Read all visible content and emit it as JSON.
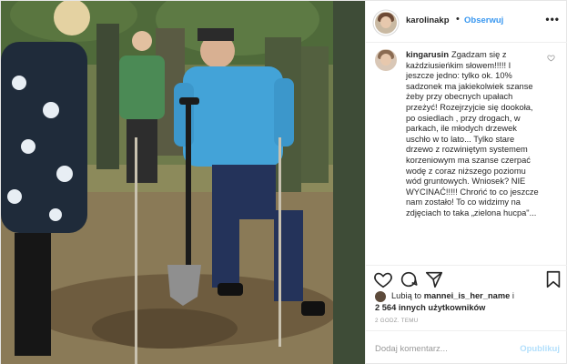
{
  "post": {
    "username": "karolinakp",
    "separator": "•",
    "follow_label": "Obserwuj",
    "more_icon": "more-options-icon"
  },
  "comment": {
    "username": "kingarusin",
    "text": "Zgadzam się z każdziusieńkim słowem!!!!! I jeszcze jedno: tylko ok. 10% sadzonek ma jakiekolwiek szanse żeby przy obecnych upałach przeżyć! Rozejrzyjcie się dookoła, po osiedlach , przy drogach, w parkach, ile młodych drzewek uschło w to lato... Tylko stare drzewo z rozwiniętym systemem korzeniowym ma szanse czerpać wodę z coraz niższego poziomu wód gruntowych. Wniosek? NIE WYCINAĆ!!!!! Chrońć to co jeszcze nam zostało! To co widzimy na zdjęciach to taka „zielona hucpa\"..."
  },
  "likes": {
    "prefix": "Lubią to",
    "user": "mannei_is_her_name",
    "conjunction": "i",
    "others": "2 564 innych użytkowników"
  },
  "time_label": "2 GODZ. TEMU",
  "add_comment": {
    "placeholder": "Dodaj komentarz...",
    "publish_label": "Opublikuj"
  },
  "colors": {
    "link_blue": "#3897f0",
    "publish_disabled": "#b2dffc",
    "muted": "#999999"
  }
}
